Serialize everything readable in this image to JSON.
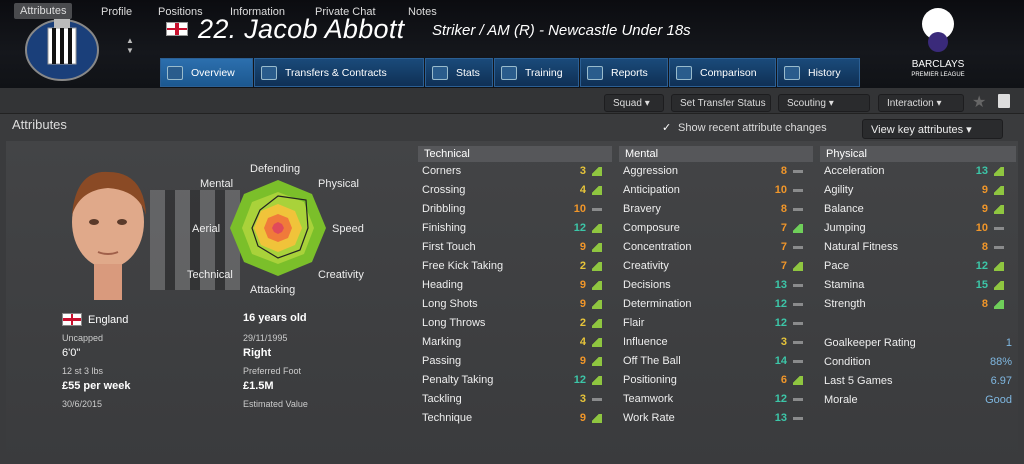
{
  "header": {
    "number_name": "22. Jacob Abbott",
    "role": "Striker / AM (R) - Newcastle Under 18s",
    "league_logo_text": "BARCLAYS",
    "league_logo_sub": "PREMIER LEAGUE"
  },
  "tabs": [
    "Overview",
    "Transfers & Contracts",
    "Stats",
    "Training",
    "Reports",
    "Comparison",
    "History"
  ],
  "subnav": [
    "Attributes",
    "Profile",
    "Positions",
    "Information",
    "Private Chat",
    "Notes"
  ],
  "actions": {
    "squad": "Squad",
    "transfer": "Set Transfer Status",
    "scouting": "Scouting",
    "interaction": "Interaction"
  },
  "section_title": "Attributes",
  "show_changes": "Show recent attribute changes",
  "view_key": "View key attributes",
  "radar": {
    "defending": "Defending",
    "mental": "Mental",
    "physical": "Physical",
    "aerial": "Aerial",
    "speed": "Speed",
    "technical": "Technical",
    "creativity": "Creativity",
    "attacking": "Attacking"
  },
  "profile": {
    "nation": "England",
    "caps": "Uncapped",
    "height": "6'0\"",
    "weight": "12 st 3 lbs",
    "wage": "£55 per week",
    "contract": "30/6/2015",
    "age": "16 years old",
    "dob": "29/11/1995",
    "foot": "Right",
    "foot_lbl": "Preferred Foot",
    "value": "£1.5M",
    "value_lbl": "Estimated Value"
  },
  "technical_hdr": "Technical",
  "mental_hdr": "Mental",
  "physical_hdr": "Physical",
  "technical": [
    [
      "Corners",
      "3",
      "yel"
    ],
    [
      "Crossing",
      "4",
      "yel"
    ],
    [
      "Dribbling",
      "10",
      "orn"
    ],
    [
      "Finishing",
      "12",
      "grn"
    ],
    [
      "First Touch",
      "9",
      "orn"
    ],
    [
      "Free Kick Taking",
      "2",
      "yel"
    ],
    [
      "Heading",
      "9",
      "orn"
    ],
    [
      "Long Shots",
      "9",
      "orn"
    ],
    [
      "Long Throws",
      "2",
      "yel"
    ],
    [
      "Marking",
      "4",
      "yel"
    ],
    [
      "Passing",
      "9",
      "orn"
    ],
    [
      "Penalty Taking",
      "12",
      "grn"
    ],
    [
      "Tackling",
      "3",
      "yel"
    ],
    [
      "Technique",
      "9",
      "orn"
    ]
  ],
  "mental": [
    [
      "Aggression",
      "8",
      "orn"
    ],
    [
      "Anticipation",
      "10",
      "orn"
    ],
    [
      "Bravery",
      "8",
      "orn"
    ],
    [
      "Composure",
      "7",
      "orn"
    ],
    [
      "Concentration",
      "7",
      "orn"
    ],
    [
      "Creativity",
      "7",
      "orn"
    ],
    [
      "Decisions",
      "13",
      "grn"
    ],
    [
      "Determination",
      "12",
      "grn"
    ],
    [
      "Flair",
      "12",
      "grn"
    ],
    [
      "Influence",
      "3",
      "yel"
    ],
    [
      "Off The Ball",
      "14",
      "grn"
    ],
    [
      "Positioning",
      "6",
      "orn"
    ],
    [
      "Teamwork",
      "12",
      "grn"
    ],
    [
      "Work Rate",
      "13",
      "grn"
    ]
  ],
  "physical": [
    [
      "Acceleration",
      "13",
      "grn"
    ],
    [
      "Agility",
      "9",
      "orn"
    ],
    [
      "Balance",
      "9",
      "orn"
    ],
    [
      "Jumping",
      "10",
      "orn"
    ],
    [
      "Natural Fitness",
      "8",
      "orn"
    ],
    [
      "Pace",
      "12",
      "grn"
    ],
    [
      "Stamina",
      "15",
      "grn"
    ],
    [
      "Strength",
      "8",
      "orn"
    ]
  ],
  "extra": [
    [
      "Goalkeeper Rating",
      "1"
    ],
    [
      "Condition",
      "88%"
    ],
    [
      "Last 5 Games",
      "6.97"
    ],
    [
      "Morale",
      "Good"
    ]
  ]
}
